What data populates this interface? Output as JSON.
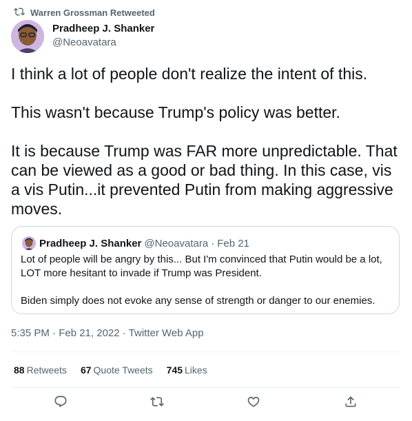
{
  "retweet": {
    "text": "Warren Grossman Retweeted"
  },
  "tweet": {
    "author_name": "Pradheep J. Shanker",
    "author_handle": "@Neoavatara",
    "text": "I think a lot of people don't realize the intent of this.\n\nThis wasn't because Trump's policy was better.\n\nIt is because Trump was FAR more unpredictable. That can be viewed as a good or bad thing. In this case, vis a vis Putin...it prevented Putin from making aggressive moves.",
    "timestamp": "5:35 PM · Feb 21, 2022 · Twitter Web App"
  },
  "quote": {
    "author_name": "Pradheep J. Shanker",
    "author_handle": "@Neoavatara",
    "separator": "·",
    "date": "Feb 21",
    "text": "Lot of people will be angry by this... But I'm convinced that Putin would be a lot, LOT more hesitant to invade if Trump was President.\n\nBiden simply does not evoke any sense of strength or danger to our enemies."
  },
  "stats": {
    "retweets_count": "88",
    "retweets_label": "Retweets",
    "quotes_count": "67",
    "quotes_label": "Quote Tweets",
    "likes_count": "745",
    "likes_label": "Likes"
  },
  "icons": {
    "retweet": "retweet-icon",
    "reply": "reply-icon",
    "like": "heart-icon",
    "share": "share-icon"
  },
  "colors": {
    "text": "#0f1419",
    "secondary": "#536471",
    "border": "#cfd9de"
  }
}
